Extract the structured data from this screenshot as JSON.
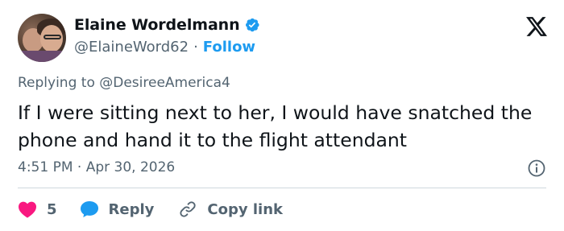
{
  "author": {
    "display_name": "Elaine Wordelmann",
    "handle": "@ElaineWord62",
    "separator": "·",
    "follow_label": "Follow",
    "verified": true
  },
  "brand": {
    "logo": "x-logo-icon"
  },
  "tweet": {
    "replying_prefix": "Replying to",
    "replying_to": "@DesireeAmerica4",
    "text": "If I were sitting next to her, I would have snatched the phone and hand it to the flight attendant",
    "timestamp": "4:51 PM · Apr 30, 2026"
  },
  "actions": {
    "like_count": "5",
    "reply_label": "Reply",
    "copy_label": "Copy link"
  },
  "colors": {
    "accent": "#1d9bf0",
    "like": "#f91880",
    "text": "#0f1419",
    "muted": "#536471",
    "divider": "#cfd9de"
  }
}
